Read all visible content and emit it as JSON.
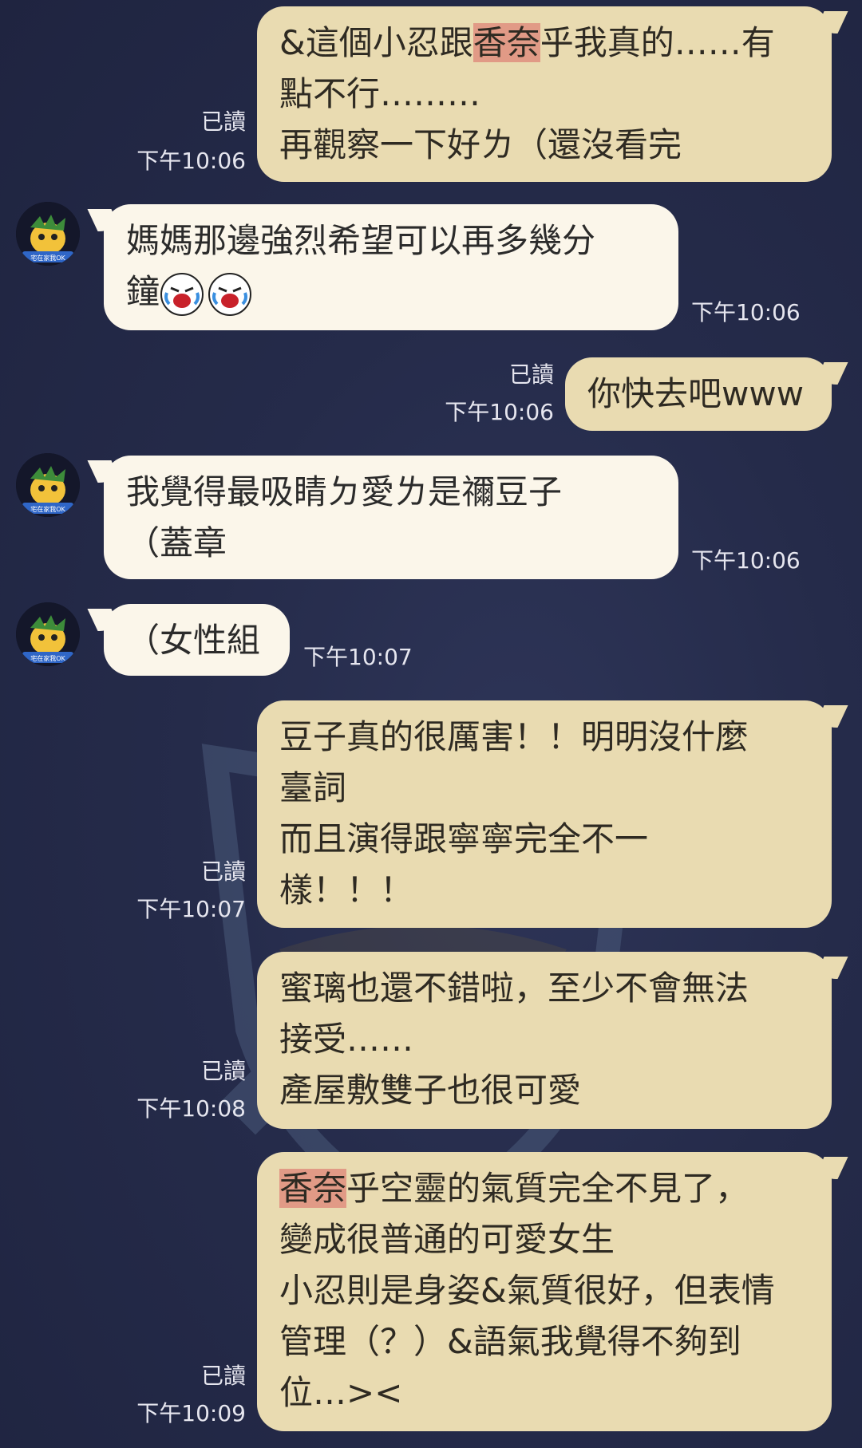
{
  "messages": [
    {
      "direction": "out",
      "read": "已讀",
      "time": "下午10:06",
      "lines": [
        {
          "pre": "&這個小忍跟",
          "hl": "香奈",
          "post": "乎我真的……有"
        },
        {
          "pre": "點不行………",
          "hl": "",
          "post": ""
        },
        {
          "pre": "再觀察一下好ㄌ（還沒看完",
          "hl": "",
          "post": ""
        }
      ]
    },
    {
      "direction": "in",
      "time": "下午10:06",
      "lines": [
        {
          "pre": "媽媽那邊強烈希望可以再多幾分",
          "hl": "",
          "post": ""
        },
        {
          "pre": "鐘",
          "hl": "",
          "post": ""
        }
      ],
      "emoji_name": "laughing-crying-face-emoji"
    },
    {
      "direction": "out",
      "read": "已讀",
      "time": "下午10:06",
      "lines": [
        {
          "pre": "你快去吧www",
          "hl": "",
          "post": ""
        }
      ]
    },
    {
      "direction": "in",
      "time": "下午10:06",
      "lines": [
        {
          "pre": "我覺得最吸睛ㄉ愛ㄌ是禰豆子",
          "hl": "",
          "post": ""
        },
        {
          "pre": "（蓋章",
          "hl": "",
          "post": ""
        }
      ]
    },
    {
      "direction": "in",
      "time": "下午10:07",
      "lines": [
        {
          "pre": "（女性組",
          "hl": "",
          "post": ""
        }
      ]
    },
    {
      "direction": "out",
      "read": "已讀",
      "time": "下午10:07",
      "lines": [
        {
          "pre": "豆子真的很厲害！！明明沒什麼",
          "hl": "",
          "post": ""
        },
        {
          "pre": "臺詞",
          "hl": "",
          "post": ""
        },
        {
          "pre": "而且演得跟寧寧完全不一",
          "hl": "",
          "post": ""
        },
        {
          "pre": "樣！！！",
          "hl": "",
          "post": ""
        }
      ]
    },
    {
      "direction": "out",
      "read": "已讀",
      "time": "下午10:08",
      "lines": [
        {
          "pre": "蜜璃也還不錯啦，至少不會無法",
          "hl": "",
          "post": ""
        },
        {
          "pre": "接受……",
          "hl": "",
          "post": ""
        },
        {
          "pre": "產屋敷雙子也很可愛",
          "hl": "",
          "post": ""
        }
      ]
    },
    {
      "direction": "out",
      "read": "已讀",
      "time": "下午10:09",
      "lines": [
        {
          "pre": "",
          "hl": "香奈",
          "post": "乎空靈的氣質完全不見了，"
        },
        {
          "pre": "變成很普通的可愛女生",
          "hl": "",
          "post": ""
        },
        {
          "pre": "小忍則是身姿&氣質很好，但表情",
          "hl": "",
          "post": ""
        },
        {
          "pre": "管理（？）&語氣我覺得不夠到",
          "hl": "",
          "post": ""
        },
        {
          "pre": "位…><",
          "hl": "",
          "post": ""
        }
      ]
    }
  ],
  "avatar_badge": "宅在家我OK",
  "colors": {
    "outgoing_bubble": "#e9dbb1",
    "incoming_bubble": "#fbf6ea",
    "highlight": "#e19a86"
  }
}
